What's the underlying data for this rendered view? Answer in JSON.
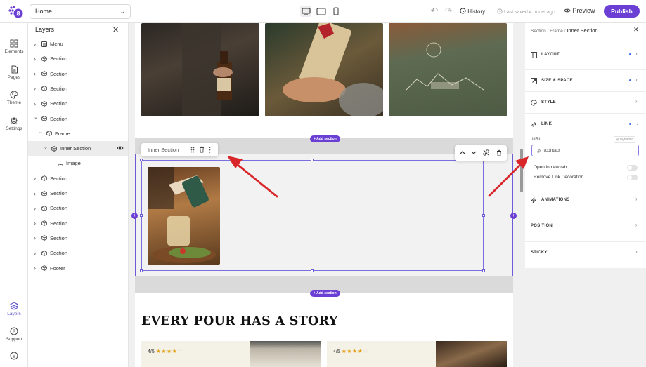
{
  "topbar": {
    "page_name": "Home",
    "history_label": "History",
    "saved_status": "Last saved 4 hours ago",
    "preview_label": "Preview",
    "publish_label": "Publish"
  },
  "rail": {
    "items": [
      {
        "label": "Elements",
        "icon": "grid-icon"
      },
      {
        "label": "Pages",
        "icon": "page-icon"
      },
      {
        "label": "Theme",
        "icon": "palette-icon"
      },
      {
        "label": "Settings",
        "icon": "gear-icon"
      }
    ],
    "bottom_items": [
      {
        "label": "Layers",
        "icon": "layers-icon"
      },
      {
        "label": "Support",
        "icon": "help-icon"
      },
      {
        "label": "",
        "icon": "info-icon"
      }
    ]
  },
  "layers": {
    "title": "Layers",
    "items": [
      {
        "label": "Menu",
        "icon": "menu-icon",
        "depth": 0,
        "expanded": false
      },
      {
        "label": "Section",
        "icon": "cube-icon",
        "depth": 0,
        "expanded": false
      },
      {
        "label": "Section",
        "icon": "cube-icon",
        "depth": 0,
        "expanded": false
      },
      {
        "label": "Section",
        "icon": "cube-icon",
        "depth": 0,
        "expanded": false
      },
      {
        "label": "Section",
        "icon": "cube-icon",
        "depth": 0,
        "expanded": false
      },
      {
        "label": "Section",
        "icon": "cube-icon",
        "depth": 0,
        "expanded": true
      },
      {
        "label": "Frame",
        "icon": "cube-icon",
        "depth": 1,
        "expanded": true
      },
      {
        "label": "Inner Section",
        "icon": "cube-icon",
        "depth": 2,
        "expanded": true,
        "selected": true
      },
      {
        "label": "Image",
        "icon": "image-icon",
        "depth": 3,
        "expanded": false
      },
      {
        "label": "Section",
        "icon": "cube-icon",
        "depth": 0,
        "expanded": false
      },
      {
        "label": "Section",
        "icon": "cube-icon",
        "depth": 0,
        "expanded": false
      },
      {
        "label": "Section",
        "icon": "cube-icon",
        "depth": 0,
        "expanded": false
      },
      {
        "label": "Section",
        "icon": "cube-icon",
        "depth": 0,
        "expanded": false
      },
      {
        "label": "Section",
        "icon": "cube-icon",
        "depth": 0,
        "expanded": false
      },
      {
        "label": "Section",
        "icon": "cube-icon",
        "depth": 0,
        "expanded": false
      },
      {
        "label": "Footer",
        "icon": "cube-icon",
        "depth": 0,
        "expanded": false
      }
    ]
  },
  "canvas": {
    "add_section_label": "+ Add section",
    "inner_section_label": "Inner Section",
    "headline": "EVERY POUR HAS A STORY",
    "cards": [
      {
        "rating": "4/5",
        "stars": 4
      },
      {
        "rating": "4/5",
        "stars": 4
      }
    ]
  },
  "inspector": {
    "breadcrumb": [
      "Section",
      "Frame",
      "Inner Section"
    ],
    "sections": [
      {
        "label": "LAYOUT",
        "icon": "layout-icon",
        "dot": true
      },
      {
        "label": "SIZE & SPACE",
        "icon": "resize-icon",
        "dot": true
      },
      {
        "label": "STYLE",
        "icon": "palette-icon",
        "dot": false
      },
      {
        "label": "LINK",
        "icon": "link-icon",
        "dot": true,
        "expanded": true
      },
      {
        "label": "ANIMATIONS",
        "icon": "bolt-icon",
        "dot": false
      },
      {
        "label": "POSITION",
        "icon": "",
        "dot": false
      },
      {
        "label": "STICKY",
        "icon": "",
        "dot": false
      }
    ],
    "link": {
      "url_label": "URL",
      "dynamic_label": "Dynamic",
      "url_value": "/contact",
      "open_new_tab_label": "Open in new tab",
      "open_new_tab": false,
      "remove_decoration_label": "Remove Link Decoration",
      "remove_decoration": false
    }
  },
  "colors": {
    "accent": "#6b3fd4",
    "selection": "#6b5bd6",
    "arrow": "#d9262b",
    "star": "#e3a21a",
    "dot": "#3b6fe0"
  }
}
